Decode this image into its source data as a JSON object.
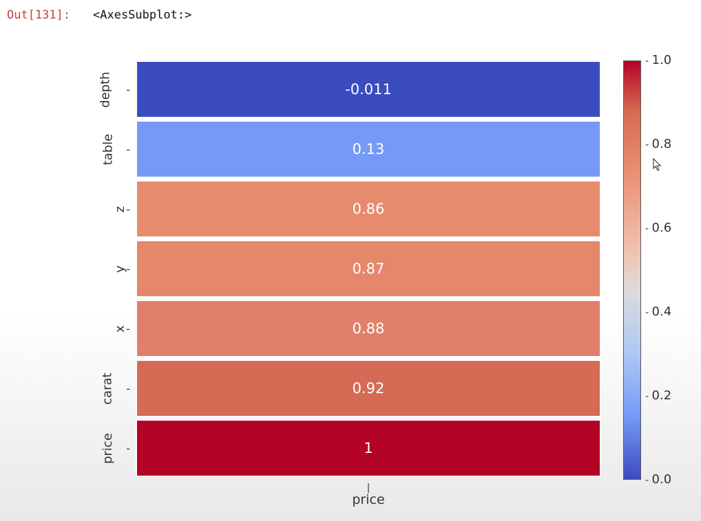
{
  "prompt": {
    "out_label": "Out[131]:",
    "out_text": "<AxesSubplot:>"
  },
  "chart_data": {
    "type": "heatmap",
    "title": "",
    "xlabel": "price",
    "ylabel": "",
    "x_categories": [
      "price"
    ],
    "y_categories": [
      "depth",
      "table",
      "z",
      "y",
      "x",
      "carat",
      "price"
    ],
    "values": [
      [
        -0.011
      ],
      [
        0.13
      ],
      [
        0.86
      ],
      [
        0.87
      ],
      [
        0.88
      ],
      [
        0.92
      ],
      [
        1
      ]
    ],
    "annotations": [
      "-0.011",
      "0.13",
      "0.86",
      "0.87",
      "0.88",
      "0.92",
      "1"
    ],
    "cell_colors": [
      "#3b4cc0",
      "#7699f6",
      "#e78b6f",
      "#e4876b",
      "#e0806a",
      "#d56b54",
      "#b30326"
    ],
    "colorbar": {
      "min": 0.0,
      "max": 1.0,
      "ticks": [
        "1.0",
        "0.8",
        "0.6",
        "0.4",
        "0.2",
        "0.0"
      ],
      "gradient_stops": [
        {
          "stop": 0,
          "color": "#b30326"
        },
        {
          "stop": 12,
          "color": "#d56b54"
        },
        {
          "stop": 25,
          "color": "#e78b6f"
        },
        {
          "stop": 45,
          "color": "#f2c1ae"
        },
        {
          "stop": 55,
          "color": "#dcdcdc"
        },
        {
          "stop": 70,
          "color": "#aec8f4"
        },
        {
          "stop": 85,
          "color": "#7699f6"
        },
        {
          "stop": 100,
          "color": "#3b4cc0"
        }
      ]
    }
  }
}
